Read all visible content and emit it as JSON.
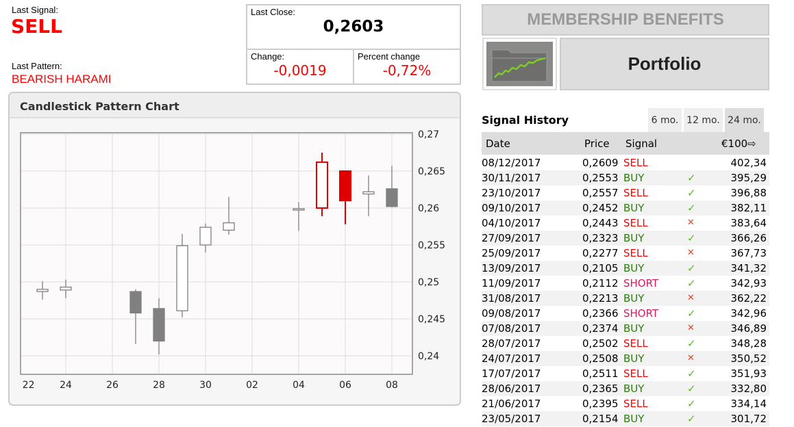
{
  "last_signal": {
    "label": "Last Signal:",
    "value": "SELL"
  },
  "last_pattern": {
    "label": "Last Pattern:",
    "value": "BEARISH HARAMI"
  },
  "quote": {
    "last_close_label": "Last Close:",
    "last_close": "0,2603",
    "change_label": "Change:",
    "change": "-0,0019",
    "pct_label": "Percent change",
    "pct": "-0,72%"
  },
  "membership": "MEMBERSHIP BENEFITS",
  "portfolio": "Portfolio",
  "colors": {
    "sell": "#ff0000",
    "buy": "#2e7d0e",
    "short": "#d81b60",
    "check": "#5cb82a",
    "cross": "#f0401e"
  },
  "chart_data": {
    "type": "candlestick",
    "title": "Candlestick Pattern Chart",
    "ylim": [
      0.2375,
      0.2703
    ],
    "yticks": [
      {
        "v": 0.27,
        "t": "0,27"
      },
      {
        "v": 0.265,
        "t": "0,265"
      },
      {
        "v": 0.26,
        "t": "0,26"
      },
      {
        "v": 0.255,
        "t": "0,255"
      },
      {
        "v": 0.25,
        "t": "0,25"
      },
      {
        "v": 0.245,
        "t": "0,245"
      },
      {
        "v": 0.24,
        "t": "0,24"
      }
    ],
    "xticks": [
      {
        "i": -0.6,
        "t": "22"
      },
      {
        "i": 1,
        "t": "24"
      },
      {
        "i": 3,
        "t": "26"
      },
      {
        "i": 5,
        "t": "28"
      },
      {
        "i": 7,
        "t": "30"
      },
      {
        "i": 9,
        "t": "02"
      },
      {
        "i": 11,
        "t": "04"
      },
      {
        "i": 13,
        "t": "06"
      },
      {
        "i": 15,
        "t": "08"
      }
    ],
    "candles": [
      {
        "i": 0,
        "o": 0.2487,
        "h": 0.2501,
        "l": 0.2476,
        "c": 0.249,
        "hl": false
      },
      {
        "i": 1,
        "o": 0.2489,
        "h": 0.2503,
        "l": 0.2478,
        "c": 0.2493,
        "hl": false
      },
      {
        "i": 4,
        "o": 0.2487,
        "h": 0.249,
        "l": 0.2416,
        "c": 0.2458,
        "hl": false
      },
      {
        "i": 5,
        "o": 0.2464,
        "h": 0.2478,
        "l": 0.2402,
        "c": 0.242,
        "hl": false
      },
      {
        "i": 6,
        "o": 0.2461,
        "h": 0.2565,
        "l": 0.2452,
        "c": 0.2549,
        "hl": false
      },
      {
        "i": 7,
        "o": 0.255,
        "h": 0.2579,
        "l": 0.254,
        "c": 0.2574,
        "hl": false
      },
      {
        "i": 8,
        "o": 0.257,
        "h": 0.2615,
        "l": 0.2564,
        "c": 0.258,
        "hl": false
      },
      {
        "i": 11,
        "o": 0.2599,
        "h": 0.2608,
        "l": 0.2569,
        "c": 0.2599,
        "hl": false
      },
      {
        "i": 12,
        "o": 0.26,
        "h": 0.2675,
        "l": 0.2589,
        "c": 0.2662,
        "hl": true
      },
      {
        "i": 13,
        "o": 0.265,
        "h": 0.265,
        "l": 0.2578,
        "c": 0.261,
        "hl": true
      },
      {
        "i": 14,
        "o": 0.2619,
        "h": 0.2644,
        "l": 0.2589,
        "c": 0.2622,
        "hl": false
      },
      {
        "i": 15,
        "o": 0.2626,
        "h": 0.2657,
        "l": 0.2601,
        "c": 0.2602,
        "hl": false
      }
    ]
  },
  "signal_history": {
    "title": "Signal History",
    "tabs": [
      "6 mo.",
      "12 mo.",
      "24 mo."
    ],
    "headers": {
      "date": "Date",
      "price": "Price",
      "signal": "Signal",
      "value": "€100⇨"
    },
    "rows": [
      {
        "date": "08/12/2017",
        "price": "0,2609",
        "signal": "SELL",
        "result": "",
        "value": "402,34"
      },
      {
        "date": "30/11/2017",
        "price": "0,2553",
        "signal": "BUY",
        "result": "check",
        "value": "395,29"
      },
      {
        "date": "23/10/2017",
        "price": "0,2557",
        "signal": "SELL",
        "result": "check",
        "value": "396,88"
      },
      {
        "date": "09/10/2017",
        "price": "0,2452",
        "signal": "BUY",
        "result": "check",
        "value": "382,11"
      },
      {
        "date": "04/10/2017",
        "price": "0,2443",
        "signal": "SELL",
        "result": "cross",
        "value": "383,64"
      },
      {
        "date": "27/09/2017",
        "price": "0,2323",
        "signal": "BUY",
        "result": "check",
        "value": "366,26"
      },
      {
        "date": "25/09/2017",
        "price": "0,2277",
        "signal": "SELL",
        "result": "cross",
        "value": "367,73"
      },
      {
        "date": "13/09/2017",
        "price": "0,2105",
        "signal": "BUY",
        "result": "check",
        "value": "341,32"
      },
      {
        "date": "11/09/2017",
        "price": "0,2112",
        "signal": "SHORT",
        "result": "check",
        "value": "342,93"
      },
      {
        "date": "31/08/2017",
        "price": "0,2213",
        "signal": "BUY",
        "result": "cross",
        "value": "362,22"
      },
      {
        "date": "09/08/2017",
        "price": "0,2366",
        "signal": "SHORT",
        "result": "check",
        "value": "342,96"
      },
      {
        "date": "07/08/2017",
        "price": "0,2374",
        "signal": "BUY",
        "result": "cross",
        "value": "346,89"
      },
      {
        "date": "28/07/2017",
        "price": "0,2502",
        "signal": "SELL",
        "result": "check",
        "value": "348,28"
      },
      {
        "date": "24/07/2017",
        "price": "0,2508",
        "signal": "BUY",
        "result": "cross",
        "value": "350,52"
      },
      {
        "date": "17/07/2017",
        "price": "0,2511",
        "signal": "SELL",
        "result": "check",
        "value": "351,93"
      },
      {
        "date": "28/06/2017",
        "price": "0,2365",
        "signal": "BUY",
        "result": "check",
        "value": "332,80"
      },
      {
        "date": "21/06/2017",
        "price": "0,2395",
        "signal": "SELL",
        "result": "check",
        "value": "334,14"
      },
      {
        "date": "23/05/2017",
        "price": "0,2154",
        "signal": "BUY",
        "result": "check",
        "value": "301,72"
      }
    ]
  }
}
